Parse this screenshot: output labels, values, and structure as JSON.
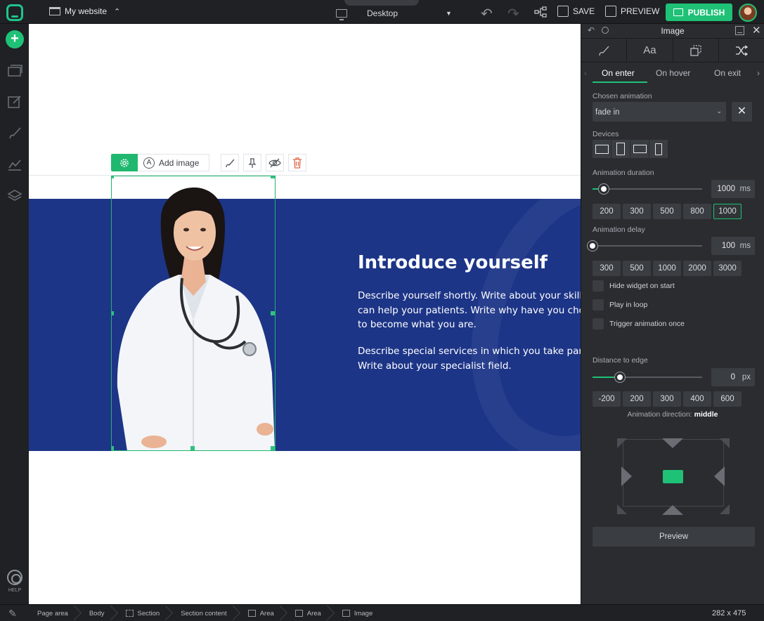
{
  "topbar": {
    "site_name": "My website",
    "device_label": "Desktop",
    "save_label": "SAVE",
    "preview_label": "PREVIEW",
    "publish_label": "PUBLISH"
  },
  "rail": {
    "help_label": "HELP"
  },
  "widget_toolbar": {
    "add_image_label": "Add image"
  },
  "hero": {
    "title": "Introduce yourself",
    "paragraph1": [
      "Describe yourself shortly. Write about your skills t",
      "can help your patients. Write why have you choo",
      "to become what you are."
    ],
    "paragraph2": [
      "Describe special services in which you take part.",
      "Write about your specialist field."
    ]
  },
  "panel": {
    "title": "Image",
    "sub_tabs": [
      "On enter",
      "On hover",
      "On exit"
    ],
    "chosen_animation_label": "Chosen animation",
    "chosen_animation_value": "fade in",
    "devices_label": "Devices",
    "duration_label": "Animation duration",
    "duration_value": "1000",
    "duration_unit": "ms",
    "duration_fraction": 0.1,
    "duration_chips": [
      "200",
      "300",
      "500",
      "800",
      "1000"
    ],
    "delay_label": "Animation delay",
    "delay_value": "100",
    "delay_unit": "ms",
    "delay_fraction": 0.0,
    "delay_chips": [
      "300",
      "500",
      "1000",
      "2000",
      "3000"
    ],
    "checkboxes": [
      "Hide widget on start",
      "Play in loop",
      "Trigger animation once"
    ],
    "distance_label": "Distance to edge",
    "distance_value": "0",
    "distance_unit": "px",
    "distance_fraction": 0.25,
    "distance_chips": [
      "-200",
      "200",
      "300",
      "400",
      "600"
    ],
    "direction_label": "Animation direction:",
    "direction_value": "middle",
    "preview_button": "Preview"
  },
  "status": {
    "crumbs": [
      "Page area",
      "Body",
      "Section",
      "Section content",
      "Area",
      "Area",
      "Image"
    ],
    "dimensions": "282 x 475"
  },
  "colors": {
    "accent": "#1fc176",
    "hero_bg": "#1d3587",
    "panel_bg": "#2a2c30"
  }
}
